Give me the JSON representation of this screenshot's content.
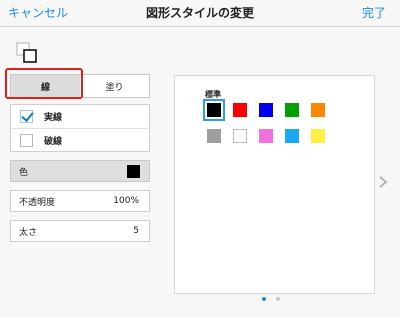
{
  "header": {
    "cancel_label": "キャンセル",
    "title": "図形スタイルの変更",
    "done_label": "完了"
  },
  "tabs": [
    {
      "label": "線",
      "active": true
    },
    {
      "label": "塗り",
      "active": false
    }
  ],
  "line_styles": [
    {
      "label": "実線",
      "checked": true
    },
    {
      "label": "破線",
      "checked": false
    }
  ],
  "color": {
    "label": "色",
    "value": "#000000"
  },
  "opacity": {
    "label": "不透明度",
    "value": "100%"
  },
  "thickness": {
    "label": "太さ",
    "value": "5"
  },
  "palette": {
    "label": "標準",
    "colors": [
      "#000000",
      "#ff0000",
      "#0000ee",
      "#00a000",
      "#ff8800",
      "#9e9e9e",
      "#ffffff",
      "#f070e0",
      "#1aa8f0",
      "#ffee44"
    ],
    "selected_index": 0
  },
  "pager": {
    "pages": 2,
    "current": 1
  },
  "accent_color": "#1a8fe0",
  "icons": [
    "shape-style-icon",
    "chevron-right-icon",
    "checkmark-icon"
  ]
}
